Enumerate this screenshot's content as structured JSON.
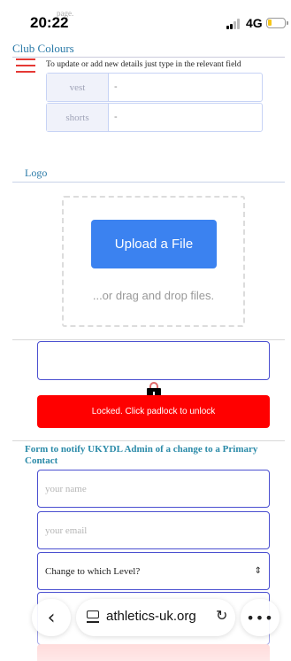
{
  "status_bar": {
    "time": "20:22",
    "ghost_text": "page.",
    "network": "4G"
  },
  "club_colours": {
    "heading": "Club Colours",
    "hint": "To update or add new details just type in the relevant field",
    "fields": [
      {
        "label": "vest",
        "value": "-"
      },
      {
        "label": "shorts",
        "value": "-"
      }
    ]
  },
  "logo": {
    "heading": "Logo",
    "upload_label": "Upload a File",
    "drop_text": "...or drag and drop files."
  },
  "lock": {
    "message": "Locked. Click padlock to unlock"
  },
  "notify_form": {
    "title": "Form to notify UKYDL Admin of a change to a Primary Contact",
    "name_placeholder": "your name",
    "email_placeholder": "your email",
    "level_select": "Change to which Level?"
  },
  "browser": {
    "url": "athletics-uk.org"
  },
  "colors": {
    "accent_blue": "#3b82f0",
    "heading_teal": "#2a7aa8",
    "locked_red": "#ff0000",
    "input_border": "#4a4fd0"
  }
}
